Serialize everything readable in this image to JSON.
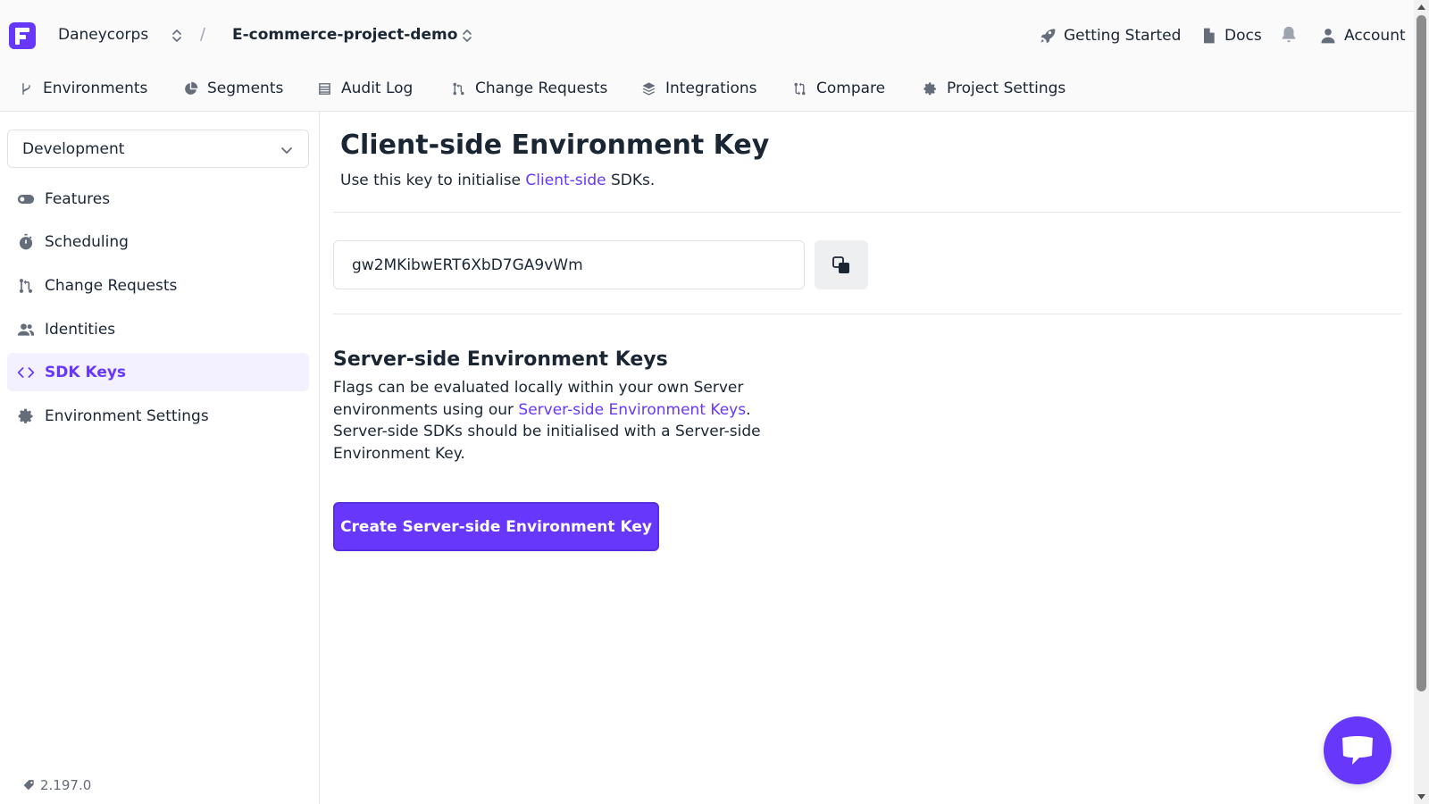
{
  "header": {
    "org_name": "Daneycorps",
    "breadcrumb_separator": "/",
    "project_name": "E-commerce-project-demo",
    "getting_started_label": "Getting Started",
    "docs_label": "Docs",
    "account_label": "Account"
  },
  "nav": {
    "environments": "Environments",
    "segments": "Segments",
    "audit_log": "Audit Log",
    "change_requests": "Change Requests",
    "integrations": "Integrations",
    "compare": "Compare",
    "project_settings": "Project Settings"
  },
  "sidebar": {
    "environment_selected": "Development",
    "items": [
      {
        "label": "Features",
        "icon": "toggle-icon"
      },
      {
        "label": "Scheduling",
        "icon": "stopwatch-icon"
      },
      {
        "label": "Change Requests",
        "icon": "git-pull-icon"
      },
      {
        "label": "Identities",
        "icon": "people-icon"
      },
      {
        "label": "SDK Keys",
        "icon": "code-icon",
        "active": true
      },
      {
        "label": "Environment Settings",
        "icon": "gear-icon"
      }
    ],
    "version": "2.197.0"
  },
  "main": {
    "title": "Client-side Environment Key",
    "subtitle_prefix": "Use this key to initialise ",
    "subtitle_link": "Client-side",
    "subtitle_suffix": " SDKs.",
    "client_key": "gw2MKibwERT6XbD7GA9vWm",
    "server_title": "Server-side Environment Keys",
    "server_p1_prefix": "Flags can be evaluated locally within your own Server environments using our ",
    "server_p1_link": "Server-side Environment Keys",
    "server_p1_suffix": ".",
    "server_p2": "Server-side SDKs should be initialised with a Server-side Environment Key.",
    "create_button": "Create Server-side Environment Key"
  },
  "colors": {
    "accent": "#6837fc",
    "active_bg": "#f3f0ff",
    "text": "#1a2634",
    "muted": "#656d7b"
  }
}
